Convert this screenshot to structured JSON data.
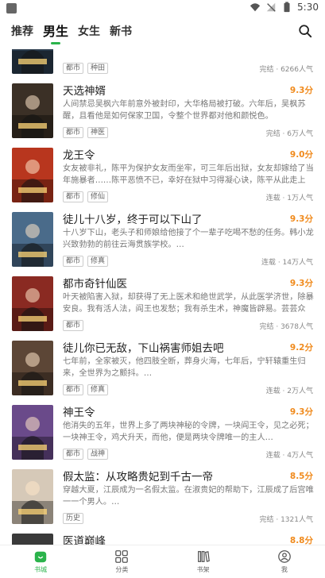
{
  "status": {
    "time": "5:30"
  },
  "header": {
    "tabs": [
      {
        "label": "推荐",
        "active": false
      },
      {
        "label": "男生",
        "active": true
      },
      {
        "label": "女生",
        "active": false
      },
      {
        "label": "新书",
        "active": false
      }
    ]
  },
  "books": [
    {
      "title": "",
      "score": "",
      "desc": "",
      "tags": [
        "都市",
        "种田"
      ],
      "meta": "完结 · 6266人气",
      "cover": "#2a3b4c"
    },
    {
      "title": "天选神婿",
      "score": "9.3分",
      "desc": "人间禁忌吴枫六年前意外被封印，大华格局被打破。六年后，吴枫苏醒，且看他是如何保家卫国，令整个世界都对他和颜悦色。",
      "tags": [
        "都市",
        "神医"
      ],
      "meta": "完结 · 6万人气",
      "cover": "#3b3026"
    },
    {
      "title": "龙王令",
      "score": "9.0分",
      "desc": "女友被非礼，陈平为保护女友而坐牢，可三年后出狱，女友却嫁给了当年施暴者……陈平恶愤不已，幸好在狱中习得凝心诀，陈平从此走上修…",
      "tags": [
        "都市",
        "修仙"
      ],
      "meta": "连载 · 1万人气",
      "cover": "#b8361e"
    },
    {
      "title": "徒儿十八岁，终于可以下山了",
      "score": "9.3分",
      "desc": "十八岁下山，老头子和师娘给他接了个一辈子吃喝不愁的任务。韩小龙兴致勃勃的前往云海贯族学校。…",
      "tags": [
        "都市",
        "修真"
      ],
      "meta": "连载 · 14万人气",
      "cover": "#4a6b8a"
    },
    {
      "title": "都市奇针仙医",
      "score": "9.3分",
      "desc": "叶天被陷害入狱，却获得了无上医术和绝世武学，从此医学济世，除暴安良。我有活人法，阎王也发愁；我有杀生术，神魔皆辟易。芸芸众生，…",
      "tags": [
        "都市"
      ],
      "meta": "完结 · 3678人气",
      "cover": "#8a2a22"
    },
    {
      "title": "徒儿你已无敌，下山祸害师姐去吧",
      "score": "9.2分",
      "desc": "七年前，全家被灭，他四肢全断，葬身火海，七年后，宁轩辕重生归来，全世界为之颤抖。…",
      "tags": [
        "都市",
        "修真"
      ],
      "meta": "连载 · 2万人气",
      "cover": "#5c4636"
    },
    {
      "title": "神王令",
      "score": "9.3分",
      "desc": "他消失的五年，世界上多了两块神秘的令牌，一块阎王令，见之必死；一块神王令，鸡犬升天，而他，便是两块令牌唯一的主人…",
      "tags": [
        "都市",
        "战神"
      ],
      "meta": "连载 · 4万人气",
      "cover": "#6a4a8a"
    },
    {
      "title": "假太监：从攻略贵妃到千古一帝",
      "score": "8.5分",
      "desc": "穿越大夏，江辰成为一名假太监。在淑贵妃的帮助下，江辰成了后宫唯一一个男人。…",
      "tags": [
        "历史"
      ],
      "meta": "完结 · 1321人气",
      "cover": "#d6c9b8"
    },
    {
      "title": "医道巅峰",
      "score": "8.8分",
      "desc": "",
      "tags": [],
      "meta": "",
      "cover": "#3a3a3a"
    }
  ],
  "nav": [
    {
      "label": "书城",
      "icon": "bookstore-icon",
      "active": true
    },
    {
      "label": "分类",
      "icon": "category-icon",
      "active": false
    },
    {
      "label": "书架",
      "icon": "bookshelf-icon",
      "active": false
    },
    {
      "label": "我",
      "icon": "profile-icon",
      "active": false
    }
  ],
  "colors": {
    "accent": "#2bb34b",
    "score": "#f08a1c"
  }
}
